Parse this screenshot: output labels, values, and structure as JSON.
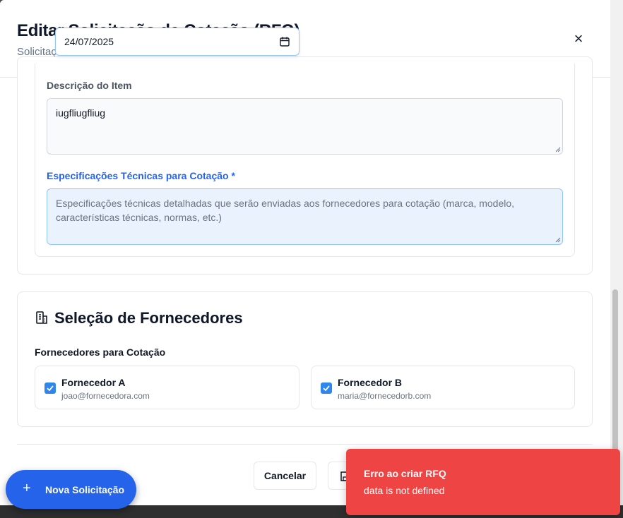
{
  "modal": {
    "title": "Editar Solicitação de Cotação (RFQ)",
    "subtitle": "Solicitação",
    "close_label": "×"
  },
  "date_picker": {
    "value": "24/07/2025",
    "icon": "calendar-icon"
  },
  "item": {
    "description_label": "Descrição do Item",
    "description_value": "iugfliugfliug",
    "specs_label": "Especificações Técnicas para Cotação *",
    "specs_placeholder": "Especificações técnicas detalhadas que serão enviadas aos fornecedores para cotação (marca, modelo, características técnicas, normas, etc.)"
  },
  "suppliers": {
    "title": "Seleção de Fornecedores",
    "icon": "building-icon",
    "list_label": "Fornecedores para Cotação",
    "items": [
      {
        "name": "Fornecedor A",
        "email": "joao@fornecedora.com",
        "checked": true
      },
      {
        "name": "Fornecedor B",
        "email": "maria@fornecedorb.com",
        "checked": true
      }
    ]
  },
  "footer": {
    "cancel_label": "Cancelar",
    "save_icon": "save-icon"
  },
  "fab": {
    "label": "Nova Solicitação",
    "icon": "plus-icon"
  },
  "toast": {
    "title": "Erro ao criar RFQ",
    "message": "data is not defined",
    "color": "#ef4444"
  },
  "colors": {
    "primary": "#2563eb",
    "checkbox": "#2f86eb",
    "error": "#ef4444"
  }
}
